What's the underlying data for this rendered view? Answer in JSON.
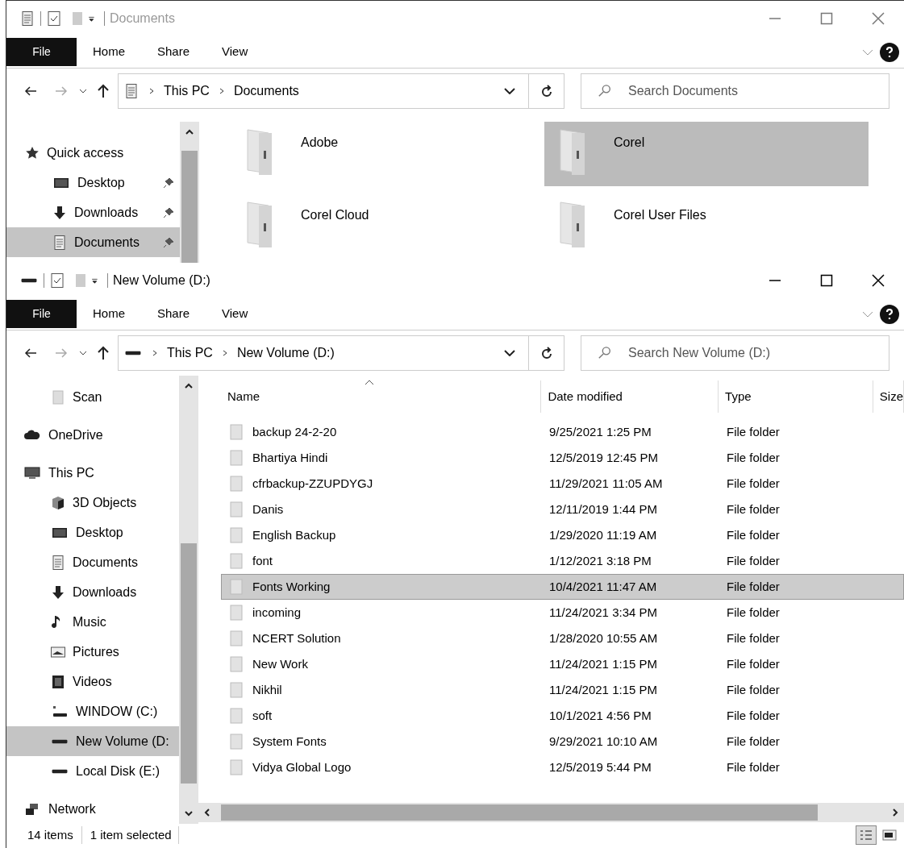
{
  "back_window": {
    "title": "Documents",
    "active": false,
    "ribbon_tabs": [
      {
        "label": "File",
        "kind": "file"
      },
      {
        "label": "Home",
        "kind": "tab"
      },
      {
        "label": "Share",
        "kind": "tab"
      },
      {
        "label": "View",
        "kind": "tab"
      }
    ],
    "address": {
      "kind": "documents",
      "path": [
        "This PC",
        "Documents"
      ]
    },
    "search": {
      "placeholder": "Search Documents"
    },
    "nav": [
      {
        "label": "Quick access",
        "kind": "star",
        "selected": false,
        "children": [
          {
            "label": "Desktop",
            "kind": "desktop",
            "selected": false,
            "pinned": true
          },
          {
            "label": "Downloads",
            "kind": "download",
            "selected": false,
            "pinned": true
          },
          {
            "label": "Documents",
            "kind": "documents",
            "selected": true,
            "pinned": true
          }
        ]
      }
    ],
    "tiles": [
      {
        "name": "Adobe",
        "selected": false
      },
      {
        "name": "Corel",
        "selected": true
      },
      {
        "name": "Corel Cloud",
        "selected": false
      },
      {
        "name": "Corel User Files",
        "selected": false
      }
    ]
  },
  "front_window": {
    "title": "New Volume (D:)",
    "active": true,
    "ribbon_tabs": [
      {
        "label": "File",
        "kind": "file"
      },
      {
        "label": "Home",
        "kind": "tab"
      },
      {
        "label": "Share",
        "kind": "tab"
      },
      {
        "label": "View",
        "kind": "tab"
      }
    ],
    "address": {
      "kind": "drive",
      "path": [
        "This PC",
        "New Volume (D:)"
      ]
    },
    "search": {
      "placeholder": "Search New Volume (D:)"
    },
    "nav": [
      {
        "label": "Scan",
        "kind": "folder",
        "selected": false
      },
      {
        "label": "OneDrive",
        "kind": "cloud",
        "selected": false
      },
      {
        "label": "This PC",
        "kind": "pc",
        "selected": false,
        "children": [
          {
            "label": "3D Objects",
            "kind": "cube",
            "selected": false
          },
          {
            "label": "Desktop",
            "kind": "desktop",
            "selected": false
          },
          {
            "label": "Documents",
            "kind": "documents",
            "selected": false
          },
          {
            "label": "Downloads",
            "kind": "download",
            "selected": false
          },
          {
            "label": "Music",
            "kind": "music",
            "selected": false
          },
          {
            "label": "Pictures",
            "kind": "pictures",
            "selected": false
          },
          {
            "label": "Videos",
            "kind": "videos",
            "selected": false
          },
          {
            "label": "WINDOW (C:)",
            "kind": "system_drive",
            "selected": false
          },
          {
            "label": "New Volume (D:",
            "kind": "drive",
            "selected": true
          },
          {
            "label": "Local Disk (E:)",
            "kind": "drive",
            "selected": false
          }
        ]
      },
      {
        "label": "Network",
        "kind": "network",
        "selected": false
      }
    ],
    "columns": [
      "Name",
      "Date modified",
      "Type",
      "Size"
    ],
    "rows": [
      {
        "name": "backup 24-2-20",
        "date": "9/25/2021 1:25 PM",
        "type": "File folder",
        "selected": false
      },
      {
        "name": "Bhartiya Hindi",
        "date": "12/5/2019 12:45 PM",
        "type": "File folder",
        "selected": false
      },
      {
        "name": "cfrbackup-ZZUPDYGJ",
        "date": "11/29/2021 11:05 AM",
        "type": "File folder",
        "selected": false
      },
      {
        "name": "Danis",
        "date": "12/11/2019 1:44 PM",
        "type": "File folder",
        "selected": false
      },
      {
        "name": "English Backup",
        "date": "1/29/2020 11:19 AM",
        "type": "File folder",
        "selected": false
      },
      {
        "name": "font",
        "date": "1/12/2021 3:18 PM",
        "type": "File folder",
        "selected": false
      },
      {
        "name": "Fonts Working",
        "date": "10/4/2021 11:47 AM",
        "type": "File folder",
        "selected": true
      },
      {
        "name": "incoming",
        "date": "11/24/2021 3:34 PM",
        "type": "File folder",
        "selected": false
      },
      {
        "name": "NCERT Solution",
        "date": "1/28/2020 10:55 AM",
        "type": "File folder",
        "selected": false
      },
      {
        "name": "New Work",
        "date": "11/24/2021 1:15 PM",
        "type": "File folder",
        "selected": false
      },
      {
        "name": "Nikhil",
        "date": "11/24/2021 1:15 PM",
        "type": "File folder",
        "selected": false
      },
      {
        "name": "soft",
        "date": "10/1/2021 4:56 PM",
        "type": "File folder",
        "selected": false
      },
      {
        "name": "System Fonts",
        "date": "9/29/2021 10:10 AM",
        "type": "File folder",
        "selected": false
      },
      {
        "name": "Vidya Global Logo",
        "date": "12/5/2019 5:44 PM",
        "type": "File folder",
        "selected": false
      }
    ],
    "status": {
      "count": "14 items",
      "selection": "1 item selected"
    }
  }
}
